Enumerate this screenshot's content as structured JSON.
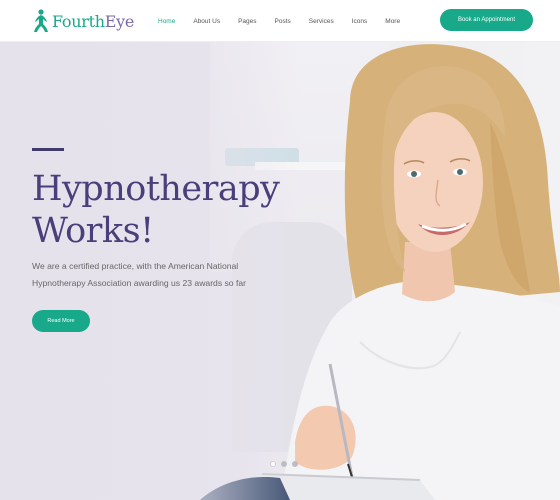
{
  "brand": {
    "name_part1": "Fourth",
    "name_part2": "Eye",
    "accent": "#18a88a"
  },
  "nav": {
    "items": [
      {
        "label": "Home",
        "active": true
      },
      {
        "label": "About Us",
        "active": false
      },
      {
        "label": "Pages",
        "active": false
      },
      {
        "label": "Posts",
        "active": false
      },
      {
        "label": "Services",
        "active": false
      },
      {
        "label": "Icons",
        "active": false
      },
      {
        "label": "More",
        "active": false
      }
    ],
    "cta_label": "Book an Appointment"
  },
  "hero": {
    "title_line1": "Hypnotherapy",
    "title_line2": "Works!",
    "description": "We are a certified practice, with the American National Hypnotherapy Association awarding us 23 awards so far",
    "button_label": "Read More",
    "slides": 3,
    "active_slide": 1,
    "title_color": "#4a3f7a"
  },
  "icons": {
    "logo": "meditating-figure-icon"
  }
}
